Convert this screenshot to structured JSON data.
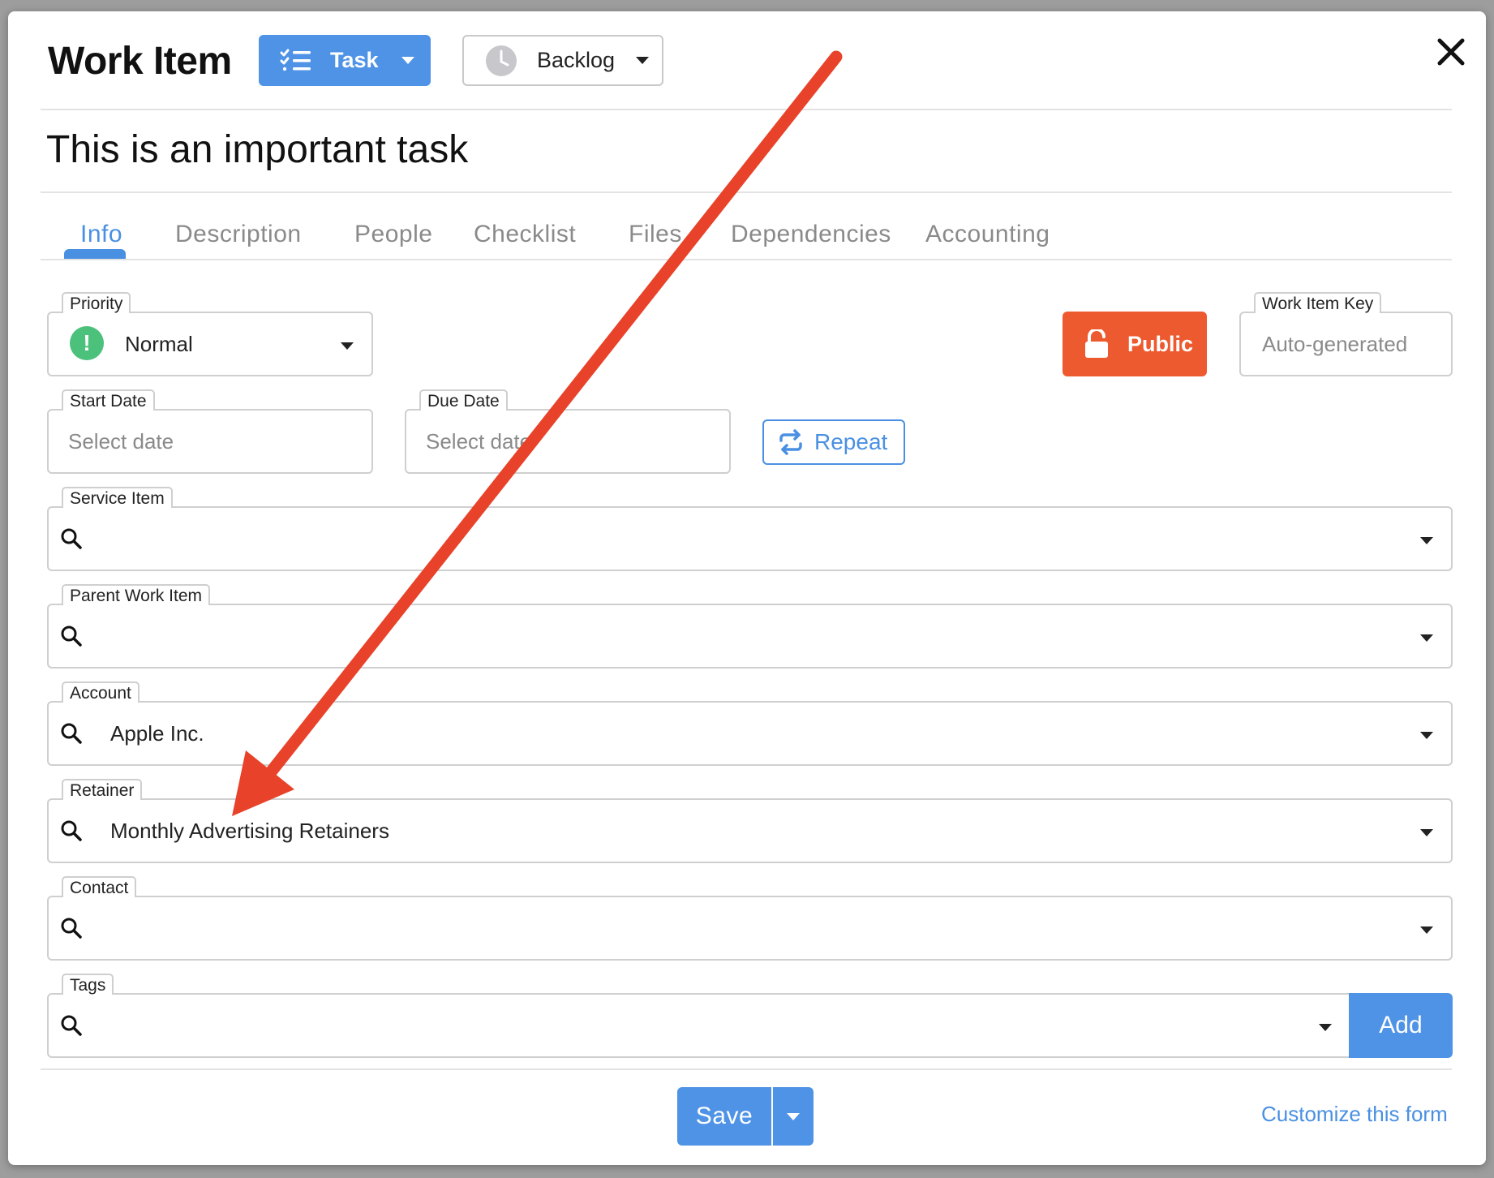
{
  "modal": {
    "title": "Work Item",
    "type_label": "Task",
    "status_label": "Backlog"
  },
  "task_title": "This is an important task",
  "tabs": [
    {
      "label": "Info"
    },
    {
      "label": "Description"
    },
    {
      "label": "People"
    },
    {
      "label": "Checklist"
    },
    {
      "label": "Files"
    },
    {
      "label": "Dependencies"
    },
    {
      "label": "Accounting"
    }
  ],
  "fields": {
    "priority": {
      "label": "Priority",
      "value": "Normal"
    },
    "visibility": {
      "label": "Public"
    },
    "work_item_key": {
      "label": "Work Item Key",
      "placeholder": "Auto-generated"
    },
    "start_date": {
      "label": "Start Date",
      "placeholder": "Select date"
    },
    "due_date": {
      "label": "Due Date",
      "placeholder": "Select date"
    },
    "repeat": {
      "label": "Repeat"
    },
    "service_item": {
      "label": "Service Item",
      "value": ""
    },
    "parent_work_item": {
      "label": "Parent Work Item",
      "value": ""
    },
    "account": {
      "label": "Account",
      "value": "Apple Inc."
    },
    "retainer": {
      "label": "Retainer",
      "value": "Monthly Advertising Retainers"
    },
    "contact": {
      "label": "Contact",
      "value": ""
    },
    "tags": {
      "label": "Tags",
      "value": "",
      "add_label": "Add"
    }
  },
  "footer": {
    "save_label": "Save",
    "customize_label": "Customize this form"
  },
  "colors": {
    "accent": "#4f93e6",
    "public": "#ee5a2f",
    "priority_normal": "#4cc17c",
    "annotation_arrow": "#e8432a"
  }
}
